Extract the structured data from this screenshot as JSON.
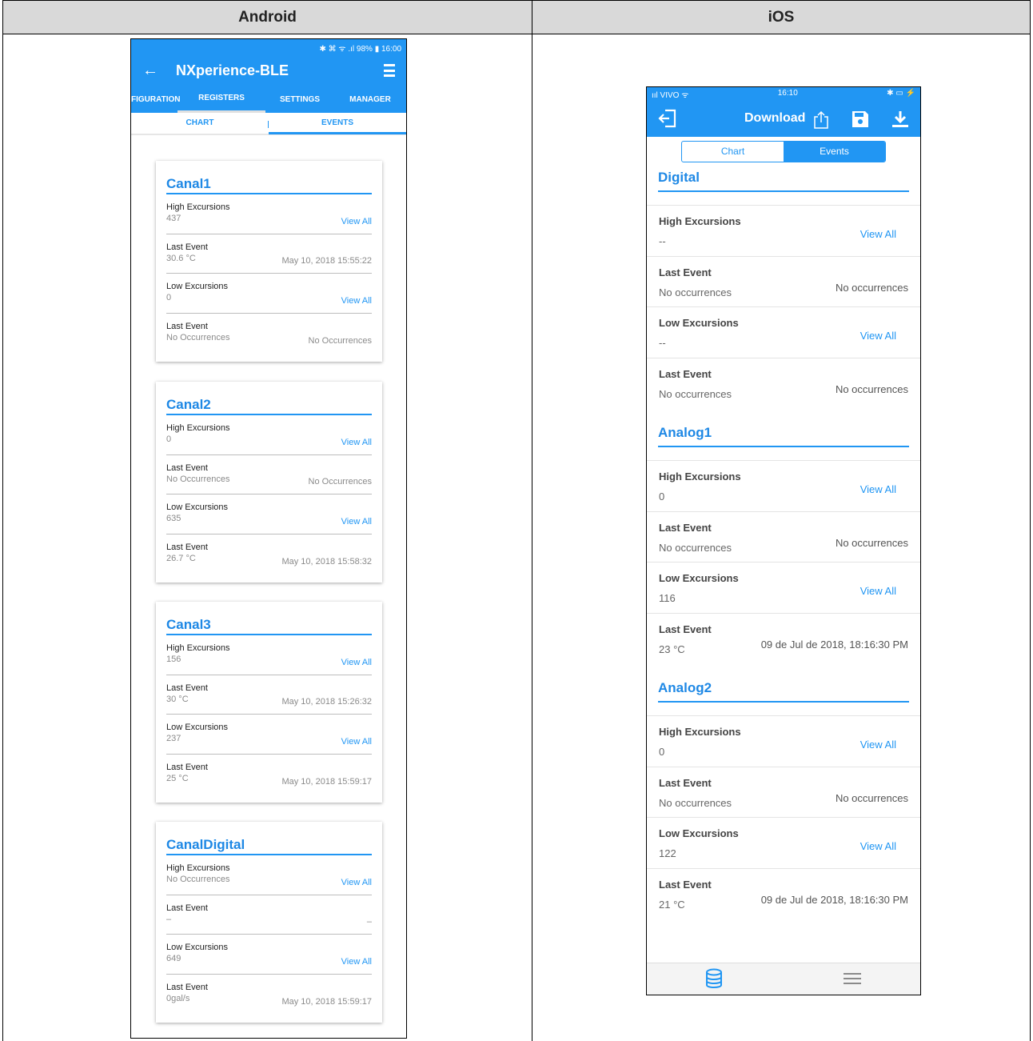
{
  "header": {
    "android_label": "Android",
    "ios_label": "iOS"
  },
  "android": {
    "status_text": "✱ ⌘ ᯤ .ıl 98% ▮ 16:00",
    "title": "NXperience-BLE",
    "back_icon": "back-arrow-icon",
    "tabs": [
      "FIGURATION",
      "REGISTERS",
      "SETTINGS",
      "MANAGER"
    ],
    "active_tab": "REGISTERS",
    "subtabs": [
      "CHART",
      "EVENTS"
    ],
    "active_subtab": "EVENTS",
    "cards": [
      {
        "title": "Canal1",
        "rows": [
          {
            "label": "High Excursions",
            "value": "437",
            "right": "View All"
          },
          {
            "label": "Last Event",
            "value": "30.6 °C",
            "right": "May 10, 2018 15:55:22"
          },
          {
            "label": "Low Excursions",
            "value": "0",
            "right": "View All"
          },
          {
            "label": "Last Event",
            "value": "No Occurrences",
            "right": "No Occurrences"
          }
        ]
      },
      {
        "title": "Canal2",
        "rows": [
          {
            "label": "High Excursions",
            "value": "0",
            "right": "View All"
          },
          {
            "label": "Last Event",
            "value": "No Occurrences",
            "right": "No Occurrences"
          },
          {
            "label": "Low Excursions",
            "value": "635",
            "right": "View All"
          },
          {
            "label": "Last Event",
            "value": "26.7 °C",
            "right": "May 10, 2018 15:58:32"
          }
        ]
      },
      {
        "title": "Canal3",
        "rows": [
          {
            "label": "High Excursions",
            "value": "156",
            "right": "View All"
          },
          {
            "label": "Last Event",
            "value": "30 °C",
            "right": "May 10, 2018 15:26:32"
          },
          {
            "label": "Low Excursions",
            "value": "237",
            "right": "View All"
          },
          {
            "label": "Last Event",
            "value": "25 °C",
            "right": "May 10, 2018 15:59:17"
          }
        ]
      },
      {
        "title": "CanalDigital",
        "rows": [
          {
            "label": "High Excursions",
            "value": "No Occurrences",
            "right": "View All"
          },
          {
            "label": "Last Event",
            "value": "–",
            "right": "–"
          },
          {
            "label": "Low Excursions",
            "value": "649",
            "right": "View All"
          },
          {
            "label": "Last Event",
            "value": "0gal/s",
            "right": "May 10, 2018 15:59:17"
          }
        ]
      }
    ]
  },
  "ios": {
    "carrier": "ııl VIVO ᯤ",
    "time": "16:10",
    "battery": "✱ ▭ ⚡",
    "title": "Download",
    "segments": [
      "Chart",
      "Events"
    ],
    "active_segment": "Events",
    "sections": [
      {
        "title": "Digital",
        "rows": [
          {
            "label": "High Excursions",
            "value": "--",
            "right": "View All"
          },
          {
            "label": "Last Event",
            "value": "No occurrences",
            "right": "No occurrences"
          },
          {
            "label": "Low Excursions",
            "value": "--",
            "right": "View All"
          },
          {
            "label": "Last Event",
            "value": "No occurrences",
            "right": "No occurrences"
          }
        ]
      },
      {
        "title": "Analog1",
        "rows": [
          {
            "label": "High Excursions",
            "value": "0",
            "right": "View All"
          },
          {
            "label": "Last Event",
            "value": "No occurrences",
            "right": "No occurrences"
          },
          {
            "label": "Low Excursions",
            "value": "116",
            "right": "View All"
          },
          {
            "label": "Last Event",
            "value": "23 °C",
            "right": "09 de Jul de 2018, 18:16:30 PM"
          }
        ]
      },
      {
        "title": "Analog2",
        "rows": [
          {
            "label": "High Excursions",
            "value": "0",
            "right": "View All"
          },
          {
            "label": "Last Event",
            "value": "No occurrences",
            "right": "No occurrences"
          },
          {
            "label": "Low Excursions",
            "value": "122",
            "right": "View All"
          },
          {
            "label": "Last Event",
            "value": "21 °C",
            "right": "09 de Jul de 2018, 18:16:30 PM"
          }
        ]
      }
    ],
    "tabbar_icons": [
      "database-icon",
      "hamburger-menu-icon"
    ]
  },
  "colors": {
    "accent": "#2196f3",
    "header_bg": "#d9d9d9"
  }
}
